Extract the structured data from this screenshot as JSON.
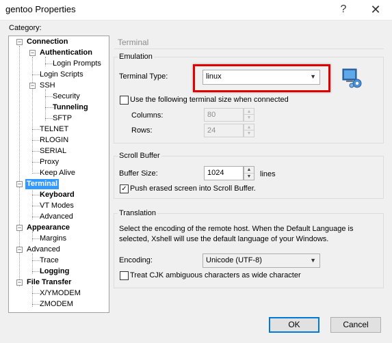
{
  "window": {
    "title": "gentoo Properties",
    "help_icon": "?",
    "close_icon": "✕"
  },
  "category_label": "Category:",
  "tree": {
    "items": [
      {
        "label": "Connection",
        "bold": true,
        "expander": "−"
      },
      {
        "label": "Authentication",
        "bold": true,
        "expander": "−"
      },
      {
        "label": "Login Prompts"
      },
      {
        "label": "Login Scripts"
      },
      {
        "label": "SSH",
        "expander": "−"
      },
      {
        "label": "Security"
      },
      {
        "label": "Tunneling",
        "bold": true
      },
      {
        "label": "SFTP"
      },
      {
        "label": "TELNET"
      },
      {
        "label": "RLOGIN"
      },
      {
        "label": "SERIAL"
      },
      {
        "label": "Proxy"
      },
      {
        "label": "Keep Alive"
      },
      {
        "label": "Terminal",
        "bold": true,
        "selected": true,
        "expander": "−"
      },
      {
        "label": "Keyboard",
        "bold": true
      },
      {
        "label": "VT Modes"
      },
      {
        "label": "Advanced"
      },
      {
        "label": "Appearance",
        "bold": true,
        "expander": "−"
      },
      {
        "label": "Margins"
      },
      {
        "label": "Advanced",
        "expander": "−"
      },
      {
        "label": "Trace"
      },
      {
        "label": "Logging",
        "bold": true
      },
      {
        "label": "File Transfer",
        "bold": true,
        "expander": "−"
      },
      {
        "label": "X/YMODEM"
      },
      {
        "label": "ZMODEM"
      }
    ]
  },
  "panel": {
    "title": "Terminal",
    "emulation": {
      "group_title": "Emulation",
      "terminal_type_label": "Terminal Type:",
      "terminal_type_value": "linux",
      "use_size_label": "Use the following terminal size when connected",
      "use_size_checked": "",
      "columns_label": "Columns:",
      "columns_value": "80",
      "rows_label": "Rows:",
      "rows_value": "24",
      "icon": "terminal-settings-icon"
    },
    "scroll_buffer": {
      "group_title": "Scroll Buffer",
      "buffer_size_label": "Buffer Size:",
      "buffer_size_value": "1024",
      "lines_label": "lines",
      "push_erased_label": "Push erased screen into Scroll Buffer.",
      "push_erased_checked": "✓"
    },
    "translation": {
      "group_title": "Translation",
      "description": "Select the encoding of the remote host. When the Default Language is selected, Xshell will use the default language of your Windows.",
      "encoding_label": "Encoding:",
      "encoding_value": "Unicode (UTF-8)",
      "cjk_label": "Treat CJK ambiguous characters as wide character",
      "cjk_checked": ""
    }
  },
  "buttons": {
    "ok": "OK",
    "cancel": "Cancel"
  },
  "colors": {
    "selection": "#3399ff",
    "highlight_border": "#e00000",
    "default_button_border": "#0078d7"
  }
}
